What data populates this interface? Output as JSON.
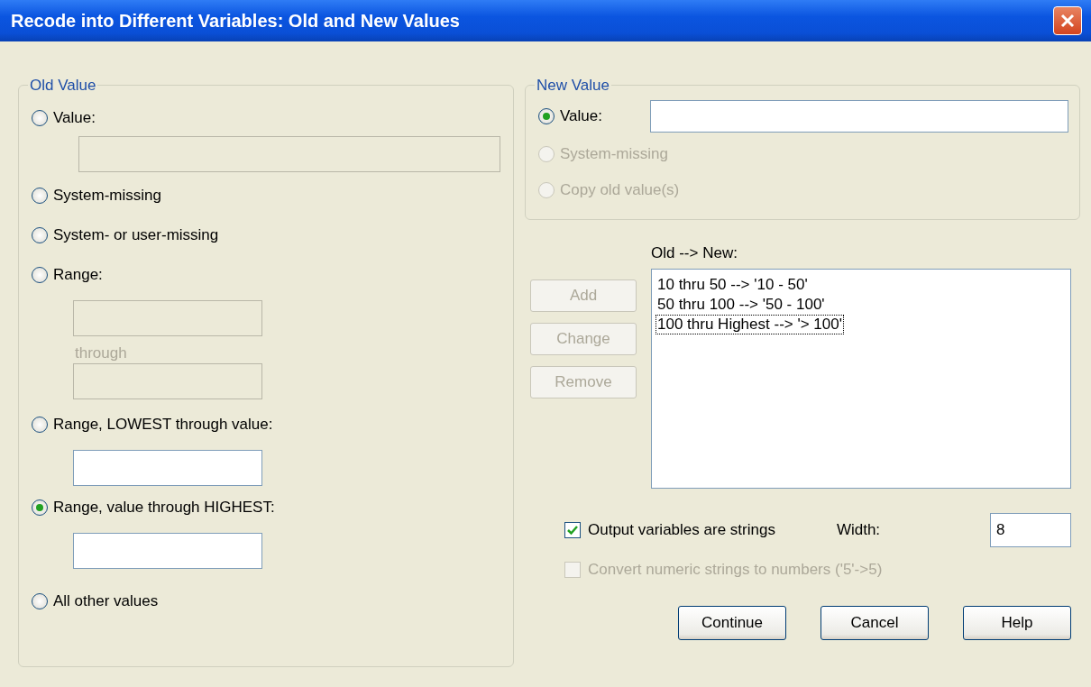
{
  "window": {
    "title": "Recode into Different Variables: Old and New Values"
  },
  "old_value": {
    "title": "Old Value",
    "options": [
      {
        "label": "Value:",
        "selected": false,
        "fields": [
          {
            "disabled": true,
            "wide": true
          }
        ]
      },
      {
        "label": "System-missing",
        "selected": false
      },
      {
        "label": "System- or user-missing",
        "selected": false
      },
      {
        "label": "Range:",
        "selected": false,
        "fields": [
          {
            "disabled": true
          },
          {
            "disabled": true
          }
        ],
        "between": "through"
      },
      {
        "label": "Range, LOWEST through value:",
        "selected": false,
        "fields": [
          {
            "disabled": false
          }
        ]
      },
      {
        "label": "Range, value through HIGHEST:",
        "selected": true,
        "fields": [
          {
            "disabled": false
          }
        ]
      },
      {
        "label": "All other values",
        "selected": false
      }
    ]
  },
  "new_value": {
    "title": "New Value",
    "options": [
      {
        "label": "Value:",
        "selected": true,
        "disabled": false,
        "has_field": true
      },
      {
        "label": "System-missing",
        "selected": false,
        "disabled": true
      },
      {
        "label": "Copy old value(s)",
        "selected": false,
        "disabled": true
      }
    ]
  },
  "mapping": {
    "label": "Old --> New:",
    "buttons": [
      {
        "label": "Add",
        "disabled": true
      },
      {
        "label": "Change",
        "disabled": true
      },
      {
        "label": "Remove",
        "disabled": true
      }
    ],
    "items": [
      {
        "text": "10 thru 50 --> '10 - 50'",
        "focused": false
      },
      {
        "text": "50 thru 100 --> '50 - 100'",
        "focused": false
      },
      {
        "text": "100 thru Highest --> '> 100'",
        "focused": true
      }
    ]
  },
  "checkboxes": [
    {
      "label": "Output variables are strings",
      "checked": true,
      "disabled": false
    },
    {
      "label": "Convert numeric strings to numbers ('5'->5)",
      "checked": false,
      "disabled": true
    }
  ],
  "width": {
    "label": "Width:",
    "value": "8"
  },
  "buttons": [
    "Continue",
    "Cancel",
    "Help"
  ]
}
